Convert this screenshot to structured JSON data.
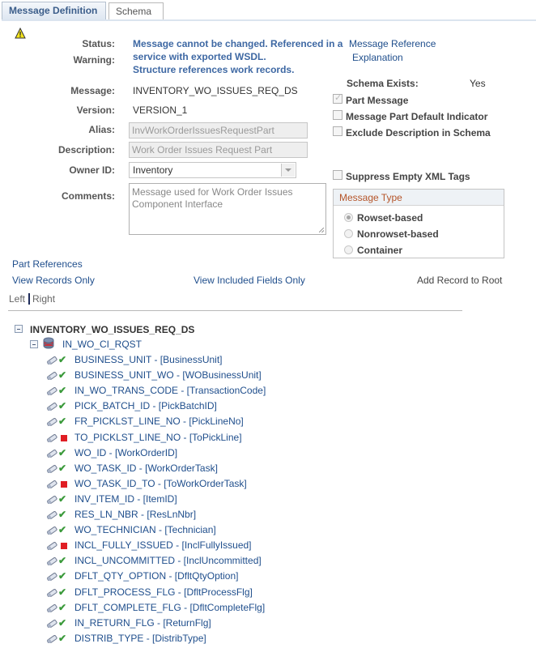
{
  "tabs": [
    {
      "label": "Message Definition",
      "active": true
    },
    {
      "label": "Schema",
      "active": false
    }
  ],
  "status": {
    "status_label": "Status:",
    "warning_label": "Warning:",
    "lines": [
      "Message cannot be changed.  Referenced in a",
      "service with exported WSDL.",
      "Structure references work records."
    ],
    "reference_link_line1": "Message Reference",
    "reference_link_line2": "Explanation"
  },
  "form": {
    "message_label": "Message:",
    "message_value": "INVENTORY_WO_ISSUES_REQ_DS",
    "version_label": "Version:",
    "version_value": "VERSION_1",
    "alias_label": "Alias:",
    "alias_value": "InvWorkOrderIssuesRequestPart",
    "description_label": "Description:",
    "description_value": "Work Order Issues Request Part",
    "owner_label": "Owner ID:",
    "owner_value": "Inventory",
    "comments_label": "Comments:",
    "comments_value": "Message used for Work Order Issues Component Interface"
  },
  "options": {
    "schema_exists_label": "Schema Exists:",
    "schema_exists_value": "Yes",
    "checkboxes": [
      {
        "label": "Part Message",
        "checked": true,
        "disabled": true
      },
      {
        "label": "Message Part Default Indicator",
        "checked": false
      },
      {
        "label": "Exclude Description in Schema",
        "checked": false
      },
      {
        "label": "Suppress Empty XML Tags",
        "checked": false
      }
    ],
    "message_type": {
      "title": "Message Type",
      "options": [
        {
          "label": "Rowset-based",
          "selected": true
        },
        {
          "label": "Nonrowset-based",
          "selected": false
        },
        {
          "label": "Container",
          "selected": false
        }
      ]
    }
  },
  "links": {
    "part_references": "Part References",
    "view_records_only": "View Records Only",
    "view_included_fields_only": "View Included Fields Only",
    "add_record_to_root": "Add Record to Root",
    "left": "Left",
    "right": "Right"
  },
  "tree": {
    "root": "INVENTORY_WO_ISSUES_REQ_DS",
    "record": "IN_WO_CI_RQST",
    "fields": [
      {
        "label": "BUSINESS_UNIT - [BusinessUnit]",
        "included": true
      },
      {
        "label": "BUSINESS_UNIT_WO - [WOBusinessUnit]",
        "included": true
      },
      {
        "label": "IN_WO_TRANS_CODE - [TransactionCode]",
        "included": true
      },
      {
        "label": "PICK_BATCH_ID - [PickBatchID]",
        "included": true
      },
      {
        "label": "FR_PICKLST_LINE_NO - [PickLineNo]",
        "included": true
      },
      {
        "label": "TO_PICKLST_LINE_NO - [ToPickLine]",
        "included": false
      },
      {
        "label": "WO_ID - [WorkOrderID]",
        "included": true
      },
      {
        "label": "WO_TASK_ID - [WorkOrderTask]",
        "included": true
      },
      {
        "label": "WO_TASK_ID_TO - [ToWorkOrderTask]",
        "included": false
      },
      {
        "label": "INV_ITEM_ID - [ItemID]",
        "included": true
      },
      {
        "label": "RES_LN_NBR - [ResLnNbr]",
        "included": true
      },
      {
        "label": "WO_TECHNICIAN - [Technician]",
        "included": true
      },
      {
        "label": "INCL_FULLY_ISSUED - [InclFullyIssued]",
        "included": false
      },
      {
        "label": "INCL_UNCOMMITTED - [InclUncommitted]",
        "included": true
      },
      {
        "label": "DFLT_QTY_OPTION - [DfltQtyOption]",
        "included": true
      },
      {
        "label": "DFLT_PROCESS_FLG - [DfltProcessFlg]",
        "included": true
      },
      {
        "label": "DFLT_COMPLETE_FLG - [DfltCompleteFlg]",
        "included": true
      },
      {
        "label": "IN_RETURN_FLG - [ReturnFlg]",
        "included": true
      },
      {
        "label": "DISTRIB_TYPE - [DistribType]",
        "included": true
      }
    ]
  },
  "colors": {
    "link": "#1f4e8c",
    "status_text": "#3e68a3",
    "message_type_title": "#b5552a",
    "included_check": "#3b9a3b",
    "excluded_square": "#e01e24"
  }
}
